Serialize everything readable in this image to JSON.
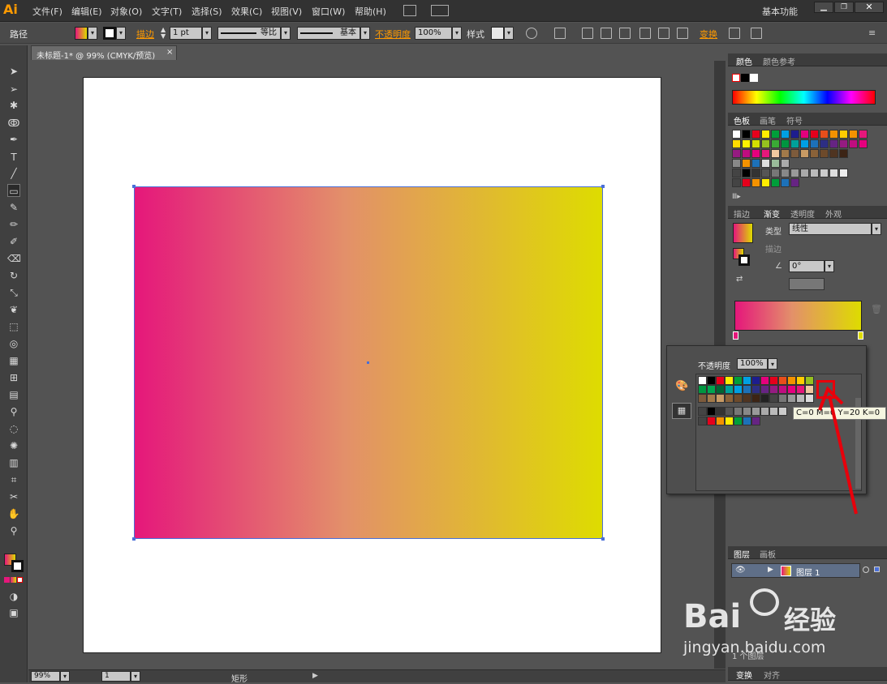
{
  "app": {
    "logo": "Ai",
    "workspace": "基本功能"
  },
  "menus": [
    "文件(F)",
    "编辑(E)",
    "对象(O)",
    "文字(T)",
    "选择(S)",
    "效果(C)",
    "视图(V)",
    "窗口(W)",
    "帮助(H)"
  ],
  "control_bar": {
    "object_type": "路径",
    "stroke_label": "描边",
    "stroke_weight": "1 pt",
    "profile_label": "等比",
    "brush_label": "基本",
    "opacity_label": "不透明度",
    "opacity_value": "100%",
    "style_label": "样式",
    "transform_label": "变换"
  },
  "document": {
    "tab_title": "未标题-1* @ 99% (CMYK/预览)",
    "close_glyph": "×"
  },
  "status": {
    "zoom": "99%",
    "page": "1",
    "tool_label": "矩形"
  },
  "color_panel": {
    "tabs": [
      "颜色",
      "颜色参考"
    ]
  },
  "swatches_panel": {
    "tabs": [
      "色板",
      "画笔",
      "符号"
    ]
  },
  "gradient_panel": {
    "tabs": [
      "描边",
      "渐变",
      "透明度",
      "外观"
    ],
    "type_label": "类型",
    "type_value": "线性",
    "stroke_label": "描边",
    "angle_value": "0°",
    "start_color": "#e5177b",
    "end_color": "#dedc00"
  },
  "layers_panel": {
    "tabs": [
      "图层",
      "画板"
    ],
    "layer_name": "图层 1",
    "footer_label": "1 个图层"
  },
  "bottom_panel": {
    "tabs": [
      "变换",
      "对齐"
    ]
  },
  "popup": {
    "opacity_label": "不透明度",
    "opacity_value": "100%",
    "tooltip": "C=0 M=0 Y=20 K=0"
  },
  "watermark": {
    "brand": "Bai",
    "brand2": "经验",
    "url": "jingyan.baidu.com"
  },
  "colors": {
    "accent": "#ff9a00",
    "selection": "#4a6fd8",
    "arrow": "#e8000b",
    "gradient_start": "#e5177b",
    "gradient_end": "#dedc00"
  }
}
